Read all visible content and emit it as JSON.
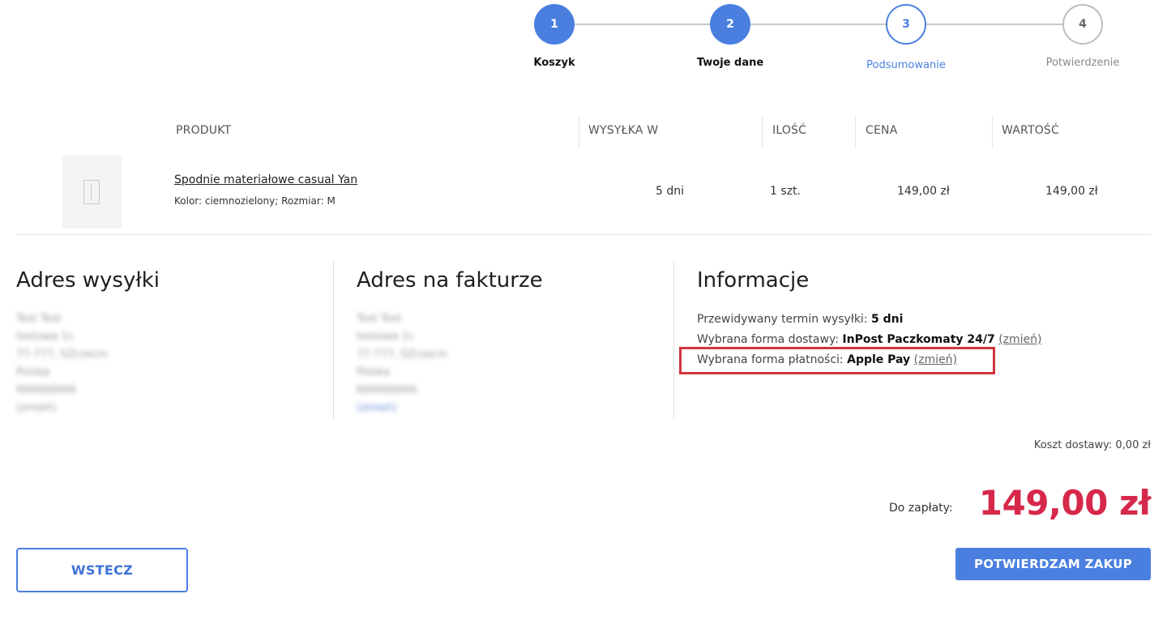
{
  "stepper": {
    "steps": [
      {
        "number": "1",
        "label": "Koszyk",
        "state": "done"
      },
      {
        "number": "2",
        "label": "Twoje dane",
        "state": "done"
      },
      {
        "number": "3",
        "label": "Podsumowanie",
        "state": "active"
      },
      {
        "number": "4",
        "label": "Potwierdzenie",
        "state": "todo"
      }
    ]
  },
  "table": {
    "headers": {
      "product": "PRODUKT",
      "shipping": "WYSYŁKA W",
      "qty": "ILOŚĆ",
      "price": "CENA",
      "value": "WARTOŚĆ"
    },
    "rows": [
      {
        "name": "Spodnie materiałowe casual Yan",
        "attributes": "Kolor: ciemnozielony; Rozmiar: M",
        "shipping": "5 dni",
        "qty": "1 szt.",
        "price": "149,00 zł",
        "value": "149,00 zł",
        "thumbnail_icon": "trousers-icon"
      }
    ]
  },
  "shipping_address": {
    "title": "Adres wysyłki",
    "lines": [
      "Test Test",
      "testowa 1c",
      "77-777, SZczecin",
      "Polska",
      "666666666",
      "(zmień)"
    ]
  },
  "billing_address": {
    "title": "Adres na fakturze",
    "lines": [
      "Test Test",
      "testowa 1c",
      "77-777, SZczecin",
      "Polska",
      "666666666"
    ],
    "change": "(zmień)"
  },
  "info": {
    "title": "Informacje",
    "eta_label": "Przewidywany termin wysyłki:",
    "eta_value": "5 dni",
    "delivery_label": "Wybrana forma dostawy:",
    "delivery_value": "InPost Paczkomaty 24/7",
    "delivery_change": "(zmień)",
    "payment_label": "Wybrana forma płatności:",
    "payment_value": "Apple Pay",
    "payment_change": "(zmień)"
  },
  "totals": {
    "shipping_cost": "Koszt dostawy: 0,00 zł",
    "to_pay_label": "Do zapłaty:",
    "to_pay_amount": "149,00 zł"
  },
  "buttons": {
    "back": "WSTECZ",
    "confirm": "POTWIERDZAM ZAKUP"
  },
  "colors": {
    "accent": "#4a7fe0",
    "price": "#d6284a",
    "highlight": "#d0353f"
  }
}
